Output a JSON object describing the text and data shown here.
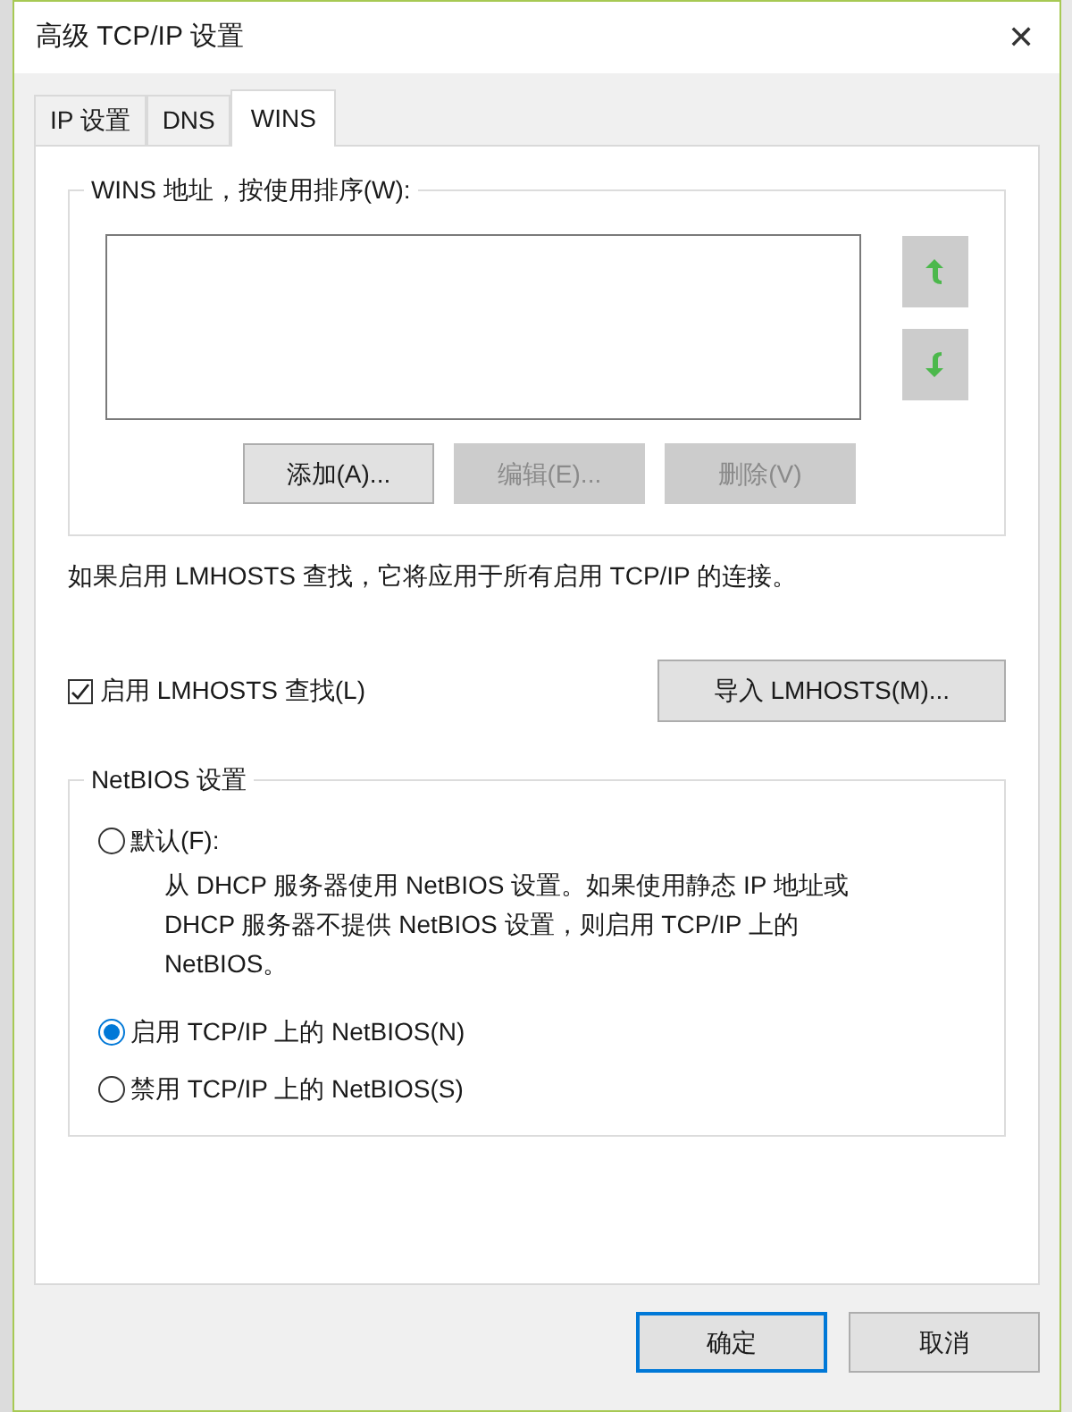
{
  "window": {
    "title": "高级 TCP/IP 设置",
    "close": "✕"
  },
  "tabs": [
    {
      "label": "IP 设置",
      "selected": false
    },
    {
      "label": "DNS",
      "selected": false
    },
    {
      "label": "WINS",
      "selected": true
    }
  ],
  "wins_group": {
    "title": "WINS 地址，按使用排序(W):",
    "buttons": [
      {
        "label": "添加(A)...",
        "disabled": false
      },
      {
        "label": "编辑(E)...",
        "disabled": true
      },
      {
        "label": "删除(V)",
        "disabled": true
      }
    ]
  },
  "lmhosts_note": "如果启用 LMHOSTS 查找，它将应用于所有启用 TCP/IP 的连接。",
  "lmhosts_checkbox": {
    "label": "启用 LMHOSTS 查找(L)",
    "checked": true
  },
  "import_button": "导入 LMHOSTS(M)...",
  "netbios": {
    "title": "NetBIOS 设置",
    "options": [
      {
        "label": "默认(F):",
        "selected": false,
        "description": "从 DHCP 服务器使用 NetBIOS 设置。如果使用静态 IP 地址或 DHCP 服务器不提供 NetBIOS 设置，则启用 TCP/IP 上的 NetBIOS。"
      },
      {
        "label": "启用 TCP/IP 上的 NetBIOS(N)",
        "selected": true
      },
      {
        "label": "禁用 TCP/IP 上的 NetBIOS(S)",
        "selected": false
      }
    ]
  },
  "footer_buttons": [
    {
      "label": "确定",
      "default": true
    },
    {
      "label": "取消",
      "default": false
    }
  ]
}
